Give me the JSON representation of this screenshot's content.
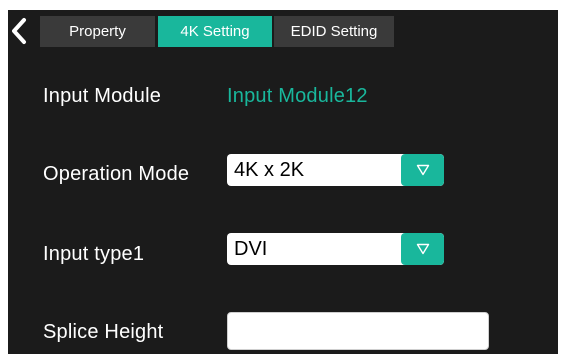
{
  "nav": {
    "back_icon": "chevron-left-icon",
    "tabs": [
      {
        "label": "Property",
        "active": false
      },
      {
        "label": "4K Setting",
        "active": true
      },
      {
        "label": "EDID Setting",
        "active": false
      }
    ]
  },
  "form": {
    "input_module": {
      "label": "Input Module",
      "value": "Input Module12"
    },
    "operation_mode": {
      "label": "Operation Mode",
      "value": "4K x 2K"
    },
    "input_type": {
      "label": "Input type1",
      "value": "DVI"
    },
    "splice_height": {
      "label": "Splice Height",
      "value": ""
    }
  },
  "colors": {
    "accent": "#19b79c",
    "panel_background": "#1b1b1b",
    "inactive_tab": "#3a3a3a",
    "text": "#ffffff"
  }
}
